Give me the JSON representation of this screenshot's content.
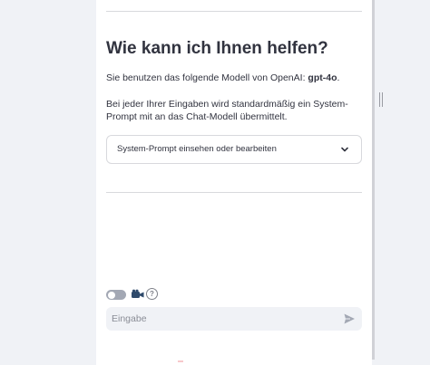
{
  "page": {
    "heading": "Wie kann ich Ihnen helfen?",
    "model_text_prefix": "Sie benutzen das folgende Modell von OpenAI: ",
    "model_name": "gpt-4o",
    "model_text_suffix": ".",
    "info_text": "Bei jeder Ihrer Eingaben wird standardmäßig ein System-Prompt mit an das Chat-Modell übermittelt."
  },
  "expander": {
    "label": "System-Prompt einsehen oder bearbeiten",
    "icon": "chevron-down-icon"
  },
  "controls": {
    "toggle_on": false,
    "camera_icon": "video-camera-icon",
    "help_icon": "help-circle-icon",
    "help_glyph": "?"
  },
  "chat_input": {
    "placeholder": "Eingabe",
    "value": "",
    "send_icon": "send-icon"
  },
  "colors": {
    "background": "#f0f2f6",
    "main": "#ffffff",
    "text": "#31333f",
    "border": "#d8d9dd"
  }
}
